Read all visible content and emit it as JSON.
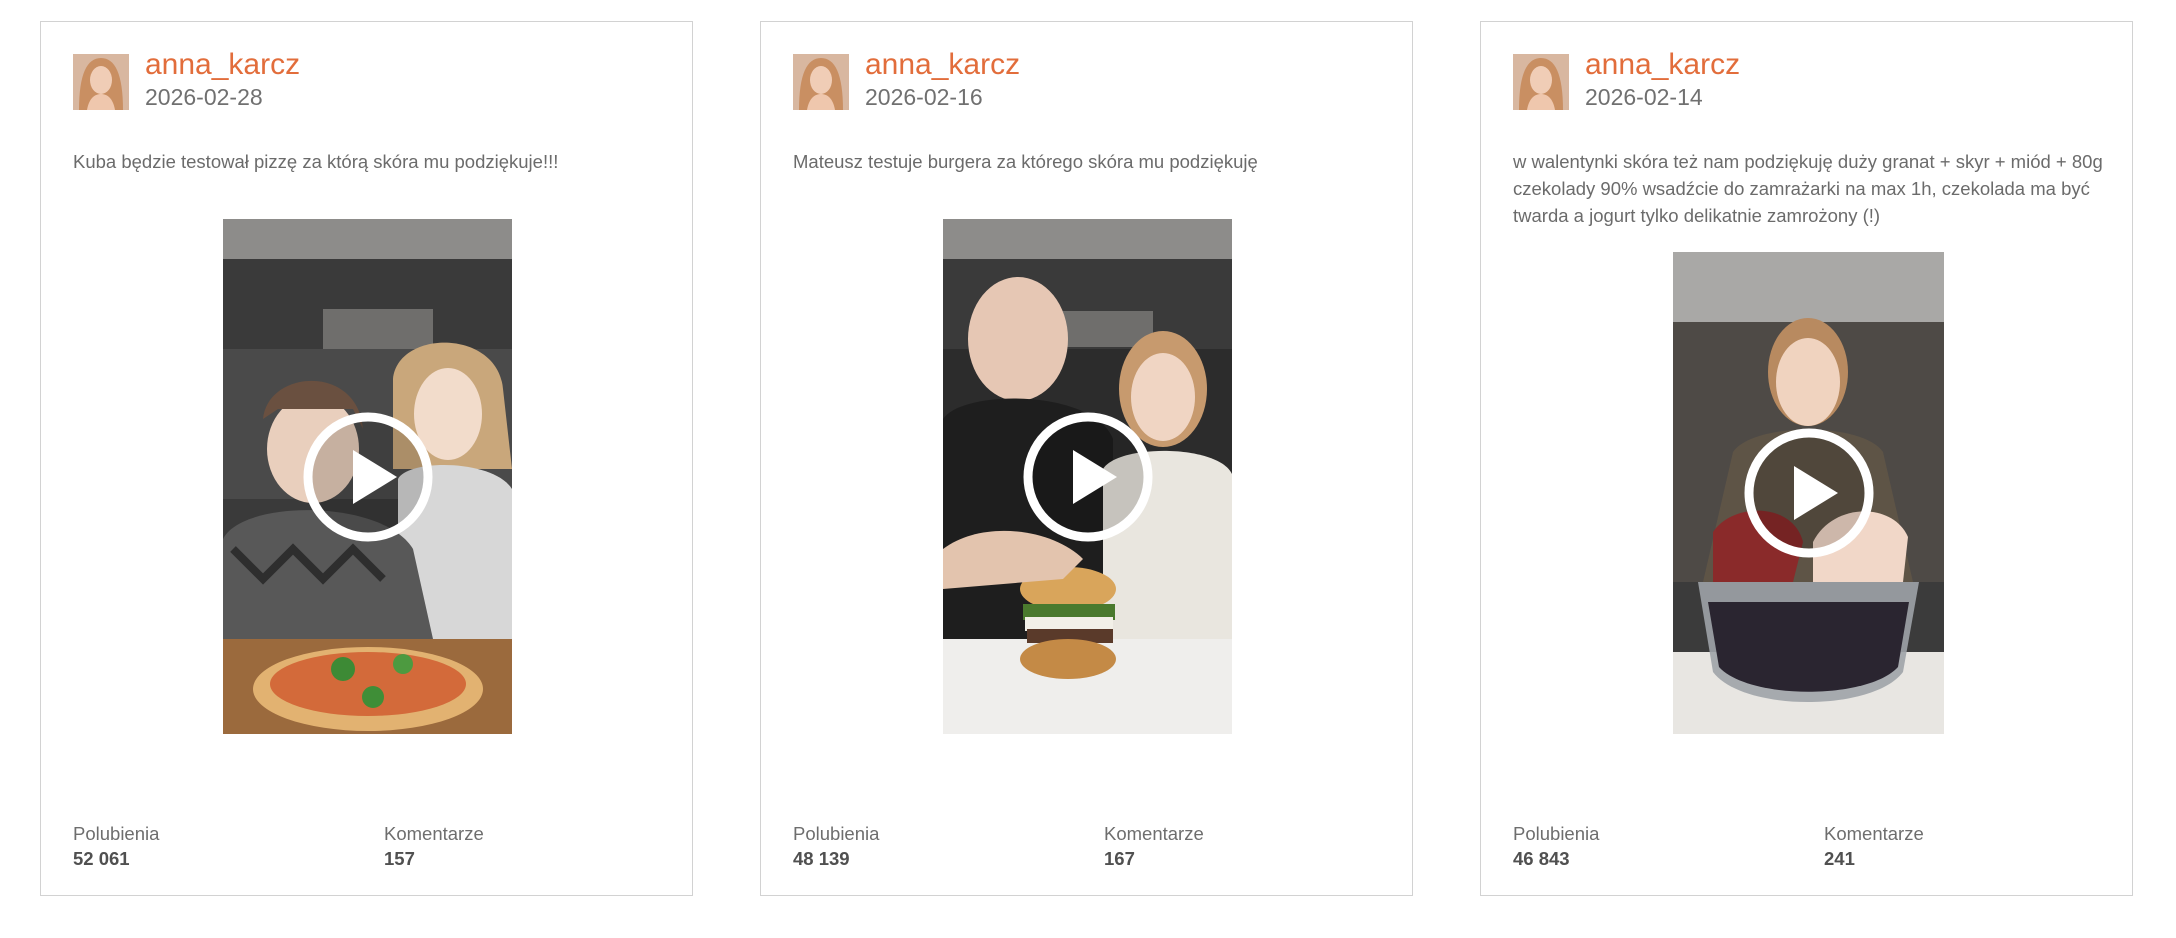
{
  "posts": [
    {
      "username": "anna_karcz",
      "date": "2026-02-28",
      "caption": "Kuba będzie testował pizzę za którą skóra mu podziękuje!!!",
      "likes_label": "Polubienia",
      "likes": "52 061",
      "comments_label": "Komentarze",
      "comments": "157",
      "play_icon": "play-icon"
    },
    {
      "username": "anna_karcz",
      "date": "2026-02-16",
      "caption": "Mateusz testuje burgera za którego skóra mu podziękuję",
      "likes_label": "Polubienia",
      "likes": "48 139",
      "comments_label": "Komentarze",
      "comments": "167",
      "play_icon": "play-icon"
    },
    {
      "username": "anna_karcz",
      "date": "2026-02-14",
      "caption": "w walentynki skóra też nam podziękuję duży granat + skyr + miód + 80g czekolady 90%  wsadźcie do zamrażarki na max 1h, czekolada ma być twarda a jogurt tylko delikatnie zamrożony (!)",
      "likes_label": "Polubienia",
      "likes": "46 843",
      "comments_label": "Komentarze",
      "comments": "241",
      "play_icon": "play-icon"
    }
  ],
  "colors": {
    "username": "#e26d3b",
    "border": "#d2d2d2",
    "text": "#6b6b6b"
  }
}
